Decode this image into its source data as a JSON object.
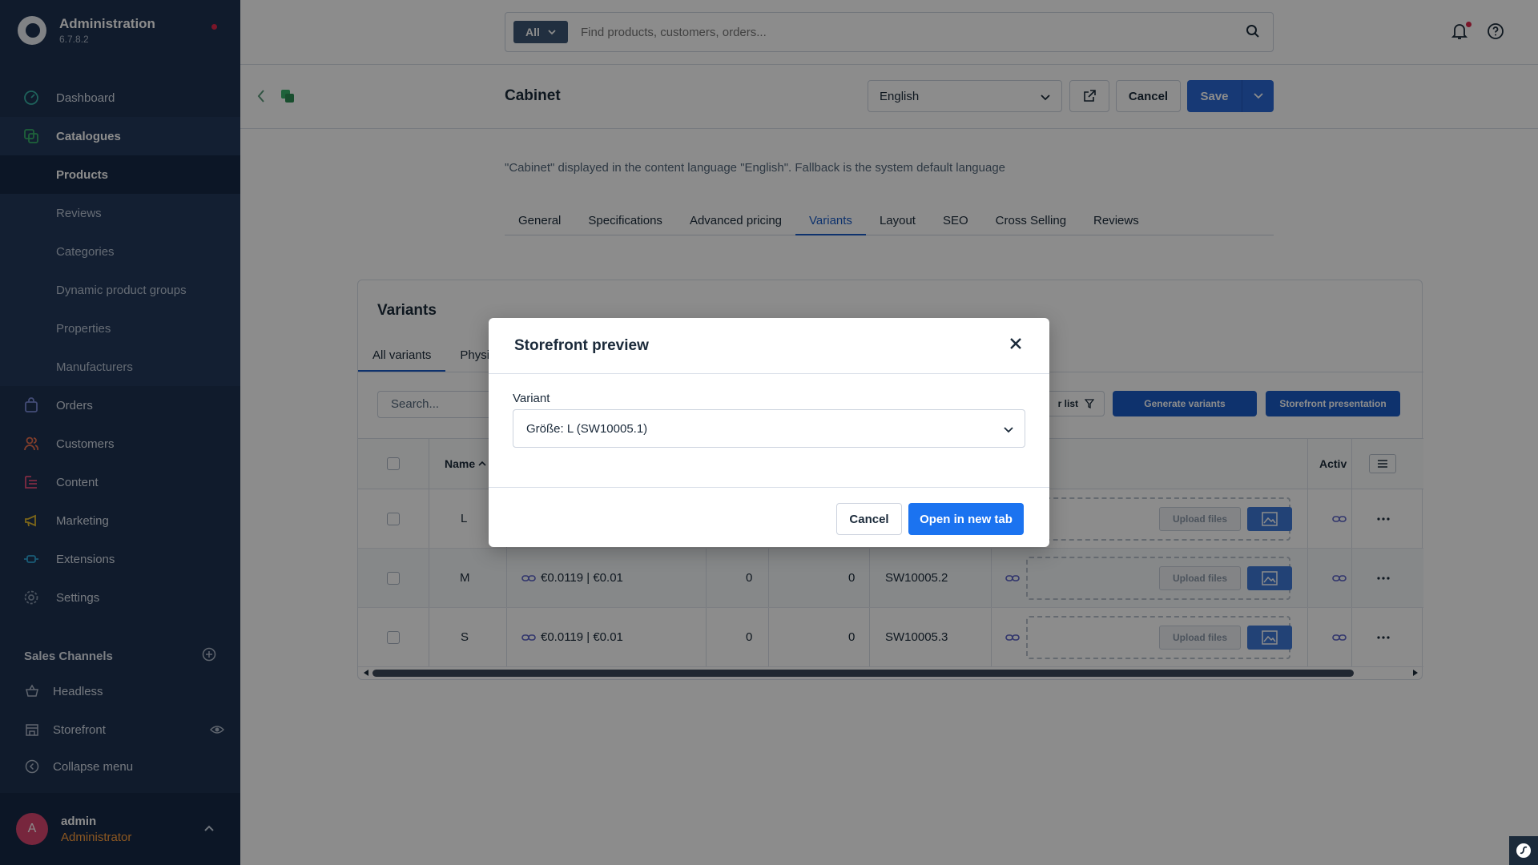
{
  "app": {
    "title": "Administration",
    "version": "6.7.8.2"
  },
  "sidebar": {
    "nav": [
      {
        "label": "Dashboard",
        "icon": "gauge-icon"
      },
      {
        "label": "Catalogues",
        "icon": "catalogue-icon"
      },
      {
        "label": "Orders",
        "icon": "bag-icon"
      },
      {
        "label": "Customers",
        "icon": "users-icon"
      },
      {
        "label": "Content",
        "icon": "content-icon"
      },
      {
        "label": "Marketing",
        "icon": "megaphone-icon"
      },
      {
        "label": "Extensions",
        "icon": "plug-icon"
      },
      {
        "label": "Settings",
        "icon": "gear-icon"
      }
    ],
    "catalogue_sub": [
      "Products",
      "Reviews",
      "Categories",
      "Dynamic product groups",
      "Properties",
      "Manufacturers"
    ],
    "sales_channels_title": "Sales Channels",
    "sales_channels": [
      "Headless",
      "Storefront"
    ],
    "collapse_label": "Collapse menu",
    "user": {
      "initial": "A",
      "name": "admin",
      "role": "Administrator"
    }
  },
  "topbar": {
    "search_type": "All",
    "search_placeholder": "Find products, customers, orders..."
  },
  "header": {
    "title": "Cabinet",
    "language": "English",
    "cancel_label": "Cancel",
    "save_label": "Save"
  },
  "content_note": "\"Cabinet\" displayed in the content language \"English\". Fallback is the system default language",
  "tabs": [
    "General",
    "Specifications",
    "Advanced pricing",
    "Variants",
    "Layout",
    "SEO",
    "Cross Selling",
    "Reviews"
  ],
  "active_tab": "Variants",
  "variants_card": {
    "title": "Variants",
    "tabs": [
      "All variants",
      "Physi"
    ],
    "search_placeholder": "Search...",
    "filter_label": "r list",
    "generate_label": "Generate variants",
    "storefront_label": "Storefront presentation",
    "columns": {
      "name": "Name",
      "active": "Activ"
    },
    "upload_label": "Upload files",
    "rows": [
      {
        "name": "L",
        "price": "",
        "stock": "",
        "available": "",
        "product_number": ""
      },
      {
        "name": "M",
        "price": "€0.0119 | €0.01",
        "stock": "0",
        "available": "0",
        "product_number": "SW10005.2"
      },
      {
        "name": "S",
        "price": "€0.0119 | €0.01",
        "stock": "0",
        "available": "0",
        "product_number": "SW10005.3"
      }
    ]
  },
  "modal": {
    "title": "Storefront preview",
    "field_label": "Variant",
    "selected_variant": "Größe: L (SW10005.1)",
    "cancel_label": "Cancel",
    "open_label": "Open in new tab"
  },
  "colors": {
    "sidebar_bg": "#1e3251",
    "primary": "#1b73f0",
    "save": "#2a69d6",
    "accent_role": "#ff9f3d"
  }
}
